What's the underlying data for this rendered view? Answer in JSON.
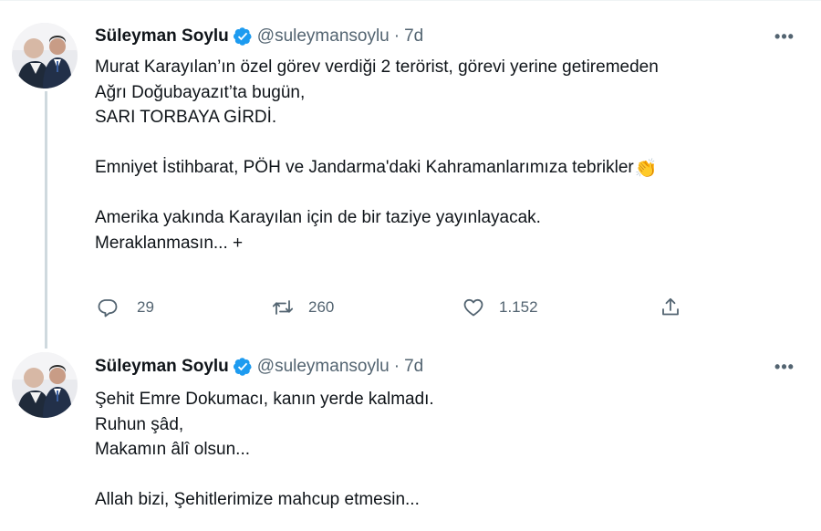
{
  "tweets": [
    {
      "author": {
        "name": "Süleyman Soylu",
        "handle": "@suleymansoylu",
        "avatar_icon": "profile-photo"
      },
      "separator": "·",
      "time": "7d",
      "more_label": "•••",
      "lines": [
        "Murat Karayılan’ın özel görev verdiği 2 terörist, görevi yerine getiremeden",
        "Ağrı Doğubayazıt’ta bugün,",
        "SARI TORBAYA GİRDİ.",
        "",
        "Emniyet İstihbarat, PÖH ve Jandarma'daki Kahramanlarımıza tebrikler",
        "",
        "Amerika yakında Karayılan için de bir taziye yayınlayacak.",
        "Meraklanmasın... +"
      ],
      "emoji": "👏",
      "actions": {
        "replies": "29",
        "retweets": "260",
        "likes": "1.152"
      }
    },
    {
      "author": {
        "name": "Süleyman Soylu",
        "handle": "@suleymansoylu",
        "avatar_icon": "profile-photo"
      },
      "separator": "·",
      "time": "7d",
      "more_label": "•••",
      "lines": [
        "Şehit Emre Dokumacı, kanın yerde kalmadı.",
        "Ruhun şâd,",
        "Makamın âlî olsun...",
        "",
        "Allah bizi, Şehitlerimize mahcup etmesin..."
      ]
    }
  ],
  "colors": {
    "verified": "#1d9bf0",
    "muted": "#536471",
    "text": "#0f1419",
    "thread_line": "#cfd9de"
  }
}
